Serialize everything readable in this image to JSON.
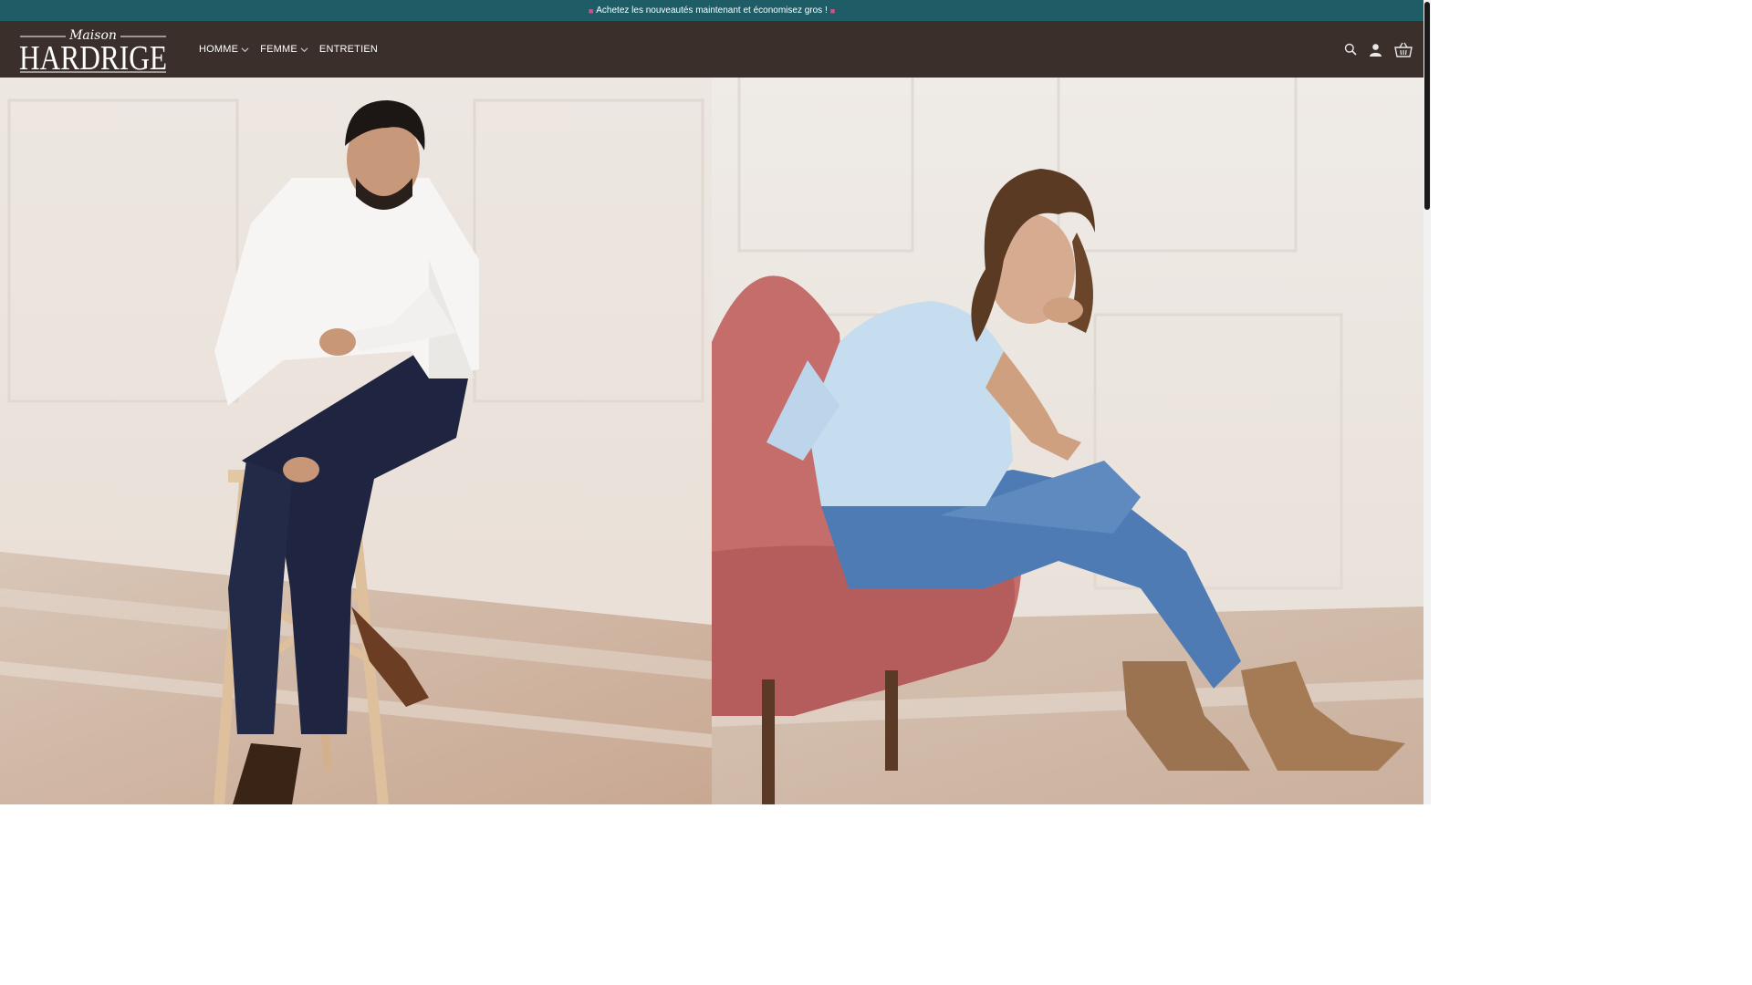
{
  "promo_bar": {
    "text": "Achetez les nouveautés maintenant et économisez gros !",
    "icon_left": "gift-icon",
    "icon_right": "gift-icon",
    "background": "#1e5c66"
  },
  "header": {
    "background": "#3a2f2b",
    "logo": {
      "script_text": "Maison",
      "main_text": "HARDRIGE"
    },
    "nav": [
      {
        "label": "HOMME",
        "has_dropdown": true
      },
      {
        "label": "FEMME",
        "has_dropdown": true
      },
      {
        "label": "ENTRETIEN",
        "has_dropdown": false
      }
    ],
    "icons": [
      "search-icon",
      "account-icon",
      "basket-icon"
    ]
  },
  "hero": {
    "panels": [
      {
        "subject": "homme",
        "description_icon": "man-photo"
      },
      {
        "subject": "femme",
        "description_icon": "woman-photo"
      }
    ]
  }
}
